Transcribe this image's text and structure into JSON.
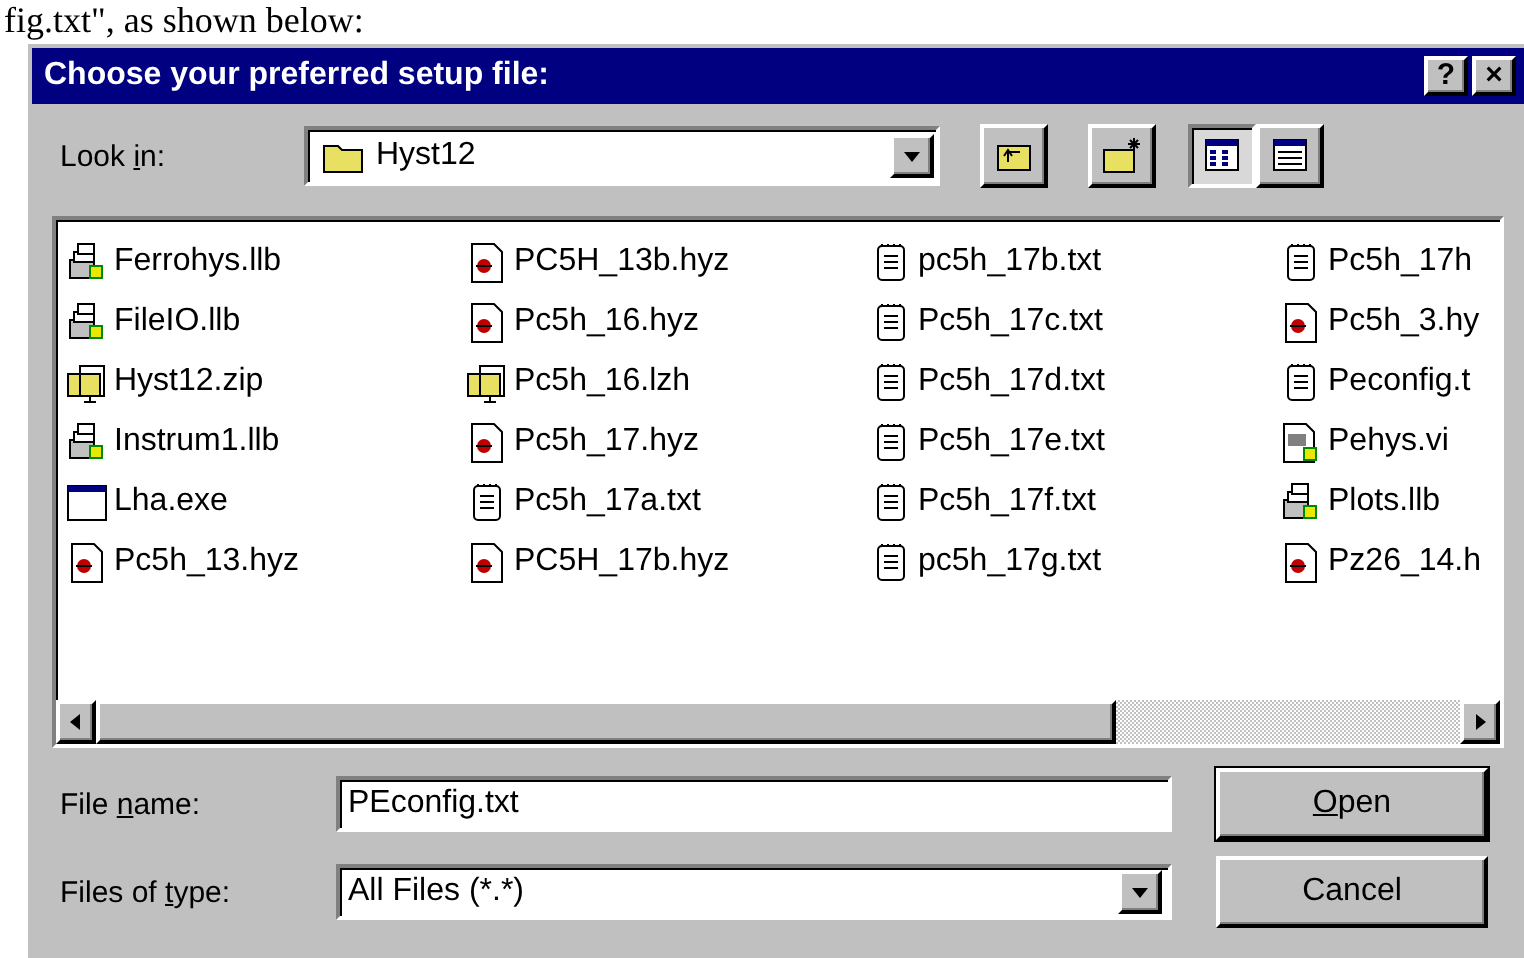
{
  "caption": "fig.txt\", as shown below:",
  "window": {
    "title": "Choose your preferred setup file:",
    "title_buttons": [
      "?",
      "×"
    ]
  },
  "look_in": {
    "label": {
      "before": "Look ",
      "key": "i",
      "after": "n:"
    },
    "value": "Hyst12"
  },
  "toolbar": [
    {
      "kind": "up-folder",
      "pressed": false
    },
    {
      "kind": "new-folder",
      "pressed": false
    },
    {
      "kind": "list-view",
      "pressed": true
    },
    {
      "kind": "details-view",
      "pressed": false
    }
  ],
  "files": [
    {
      "name": "Ferrohys.llb",
      "kind": "llb"
    },
    {
      "name": "FileIO.llb",
      "kind": "llb"
    },
    {
      "name": "Hyst12.zip",
      "kind": "zip"
    },
    {
      "name": "Instrum1.llb",
      "kind": "llb"
    },
    {
      "name": "Lha.exe",
      "kind": "exe"
    },
    {
      "name": "Pc5h_13.hyz",
      "kind": "hyz"
    },
    {
      "name": "PC5H_13b.hyz",
      "kind": "hyz"
    },
    {
      "name": "Pc5h_16.hyz",
      "kind": "hyz"
    },
    {
      "name": "Pc5h_16.lzh",
      "kind": "zip"
    },
    {
      "name": "Pc5h_17.hyz",
      "kind": "hyz"
    },
    {
      "name": "Pc5h_17a.txt",
      "kind": "txt"
    },
    {
      "name": "PC5H_17b.hyz",
      "kind": "hyz"
    },
    {
      "name": "pc5h_17b.txt",
      "kind": "txt"
    },
    {
      "name": "Pc5h_17c.txt",
      "kind": "txt"
    },
    {
      "name": "Pc5h_17d.txt",
      "kind": "txt"
    },
    {
      "name": "Pc5h_17e.txt",
      "kind": "txt"
    },
    {
      "name": "Pc5h_17f.txt",
      "kind": "txt"
    },
    {
      "name": "pc5h_17g.txt",
      "kind": "txt"
    },
    {
      "name": "Pc5h_17h",
      "kind": "txt"
    },
    {
      "name": "Pc5h_3.hy",
      "kind": "hyz"
    },
    {
      "name": "Peconfig.t",
      "kind": "txt"
    },
    {
      "name": "Pehys.vi",
      "kind": "vi"
    },
    {
      "name": "Plots.llb",
      "kind": "llb"
    },
    {
      "name": "Pz26_14.h",
      "kind": "hyz"
    }
  ],
  "file_name": {
    "label": {
      "before": "File ",
      "key": "n",
      "after": "ame:"
    },
    "value": "PEconfig.txt"
  },
  "file_type": {
    "label": {
      "before": "Files of ",
      "key": "t",
      "after": "ype:"
    },
    "value": "All Files (*.*)"
  },
  "buttons": [
    {
      "label": {
        "key": "O",
        "after": "pen"
      },
      "default": true
    },
    {
      "label": {
        "before": "Cancel"
      },
      "default": false
    }
  ]
}
